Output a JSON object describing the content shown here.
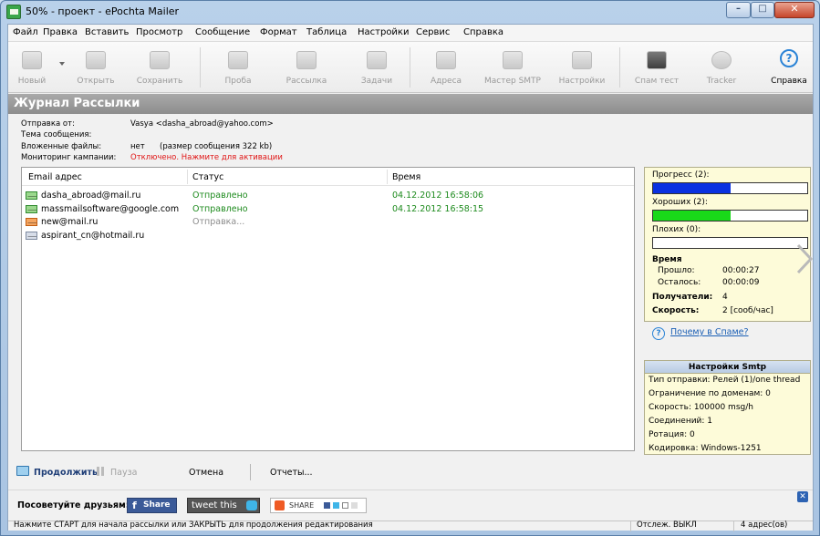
{
  "window": {
    "title": "50% - проект - ePochta Mailer"
  },
  "menu": [
    "Файл",
    "Правка",
    "Вставить",
    "Просмотр",
    "Сообщение",
    "Формат",
    "Таблица",
    "Настройки",
    "Сервис",
    "Справка"
  ],
  "toolbar": {
    "new": "Новый",
    "open": "Открыть",
    "save": "Сохранить",
    "test": "Проба",
    "send": "Рассылка",
    "tasks": "Задачи",
    "addresses": "Адреса",
    "smtp_wizard": "Мастер SMTP",
    "settings": "Настройки",
    "spam_test": "Спам тест",
    "tracker": "Tracker",
    "help": "Справка"
  },
  "journal": {
    "title": "Журнал Рассылки",
    "from_label": "Отправка от:",
    "from_value": "Vasya <dasha_abroad@yahoo.com>",
    "subject_label": "Тема сообщения:",
    "attachments_label": "Вложенные файлы:",
    "attachments_value": "нет",
    "size_value": "(размер сообщения 322 kb)",
    "monitoring_label": "Мониторинг кампании:",
    "monitoring_value": "Отключено. Нажмите для активации"
  },
  "list": {
    "columns": [
      "Email адрес",
      "Статус",
      "Время"
    ],
    "rows": [
      {
        "email": "dasha_abroad@mail.ru",
        "status": "Отправлено",
        "time": "04.12.2012 16:58:06"
      },
      {
        "email": "massmailsoftware@google.com",
        "status": "Отправлено",
        "time": "04.12.2012 16:58:15"
      },
      {
        "email": "new@mail.ru",
        "status": "Отправка...",
        "time": ""
      },
      {
        "email": "aspirant_cn@hotmail.ru",
        "status": "",
        "time": ""
      }
    ]
  },
  "progress": {
    "progress_label": "Прогресс (2):",
    "progress_level": 0.5,
    "good_label": "Хороших (2):",
    "good_level": 0.5,
    "bad_label": "Плохих (0):",
    "bad_level": 0,
    "time_label": "Время",
    "elapsed_label": "Прошло:",
    "elapsed_value": "00:00:27",
    "remaining_label": "Осталось:",
    "remaining_value": "00:00:09",
    "recipients_label": "Получатели:",
    "recipients_value": "4",
    "speed_label": "Скорость:",
    "speed_value": "2 [сооб/час]",
    "colors": {
      "progress": "#0a31e0",
      "good": "#19d919"
    }
  },
  "spam_link": "Почему в Спаме?",
  "smtp": {
    "title": "Настройки Smtp",
    "lines": [
      "Тип отправки: Релей (1)/one thread",
      "Ограничение по доменам: 0",
      "Скорость: 100000 msg/h",
      "Соединений: 1",
      "Ротация: 0",
      "Кодировка: Windows-1251"
    ]
  },
  "actions": {
    "continue": "Продолжить",
    "pause": "Пауза",
    "cancel": "Отмена",
    "reports": "Отчеты..."
  },
  "social": {
    "label": "Посоветуйте друзьям:",
    "facebook": "Share",
    "twitter": "tweet this",
    "share": "SHARE"
  },
  "statusbar": {
    "message": "Нажмите СТАРТ для начала рассылки или ЗАКРЫТЬ для продолжения редактирования",
    "tracking": "Отслеж. ВЫКЛ",
    "count": "4 адрес(ов)"
  }
}
